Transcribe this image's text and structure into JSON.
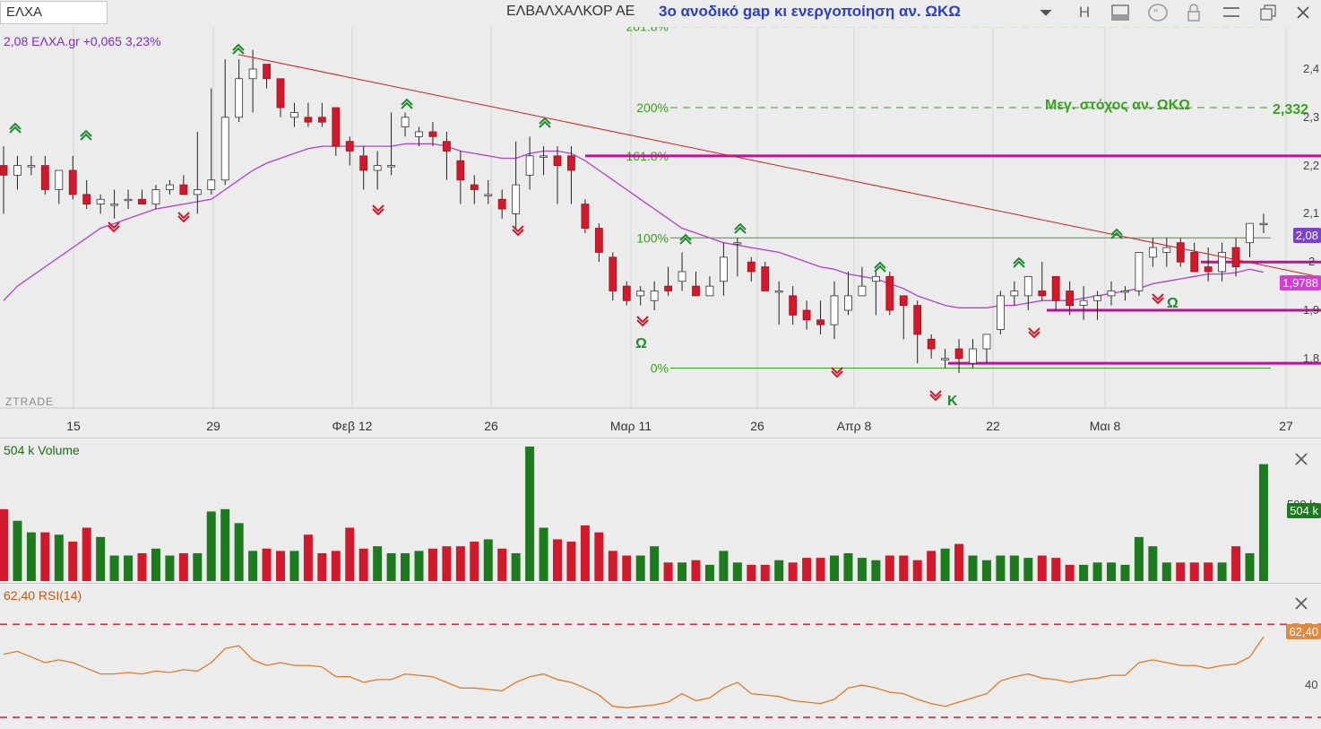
{
  "toolbar": {
    "symbol": "ΕΛΧΑ",
    "company": "ΕΛΒΑΛΧΑΛΚΟΡ ΑΕ",
    "annotation": "3ο ανοδικό gap κι ενεργοποίηση αν. ΩΚΩ",
    "h_label": "H",
    "icons": [
      "chevron-down-icon",
      "layout-icon",
      "quote-icon",
      "lock-icon",
      "menu-icon",
      "restore-icon",
      "close-icon"
    ]
  },
  "price_panel": {
    "header": "2,08 ΕΛΧΑ.gr +0,065 3,23%",
    "watermark": "ZTRADE",
    "y_ticks": [
      "2,4",
      "2,3",
      "2,2",
      "2,1",
      "2",
      "1,9",
      "1,8"
    ],
    "last_price": "2,08",
    "ma_value": "1,9788",
    "target_text": "Μεγ. στόχος αν.  ΩΚΩ",
    "target_value": "2,332",
    "fib_labels": [
      "261.8%",
      "200%",
      "161.8%",
      "100%",
      "0%"
    ],
    "pattern_labels": [
      "Ω",
      "Κ",
      "Ω"
    ]
  },
  "x_axis": {
    "labels": [
      "15",
      "29",
      "Φεβ 12",
      "26",
      "Μαρ 11",
      "26",
      "Απρ 8",
      "22",
      "Μαι 8",
      "27"
    ]
  },
  "volume_panel": {
    "header": "504 k Volume",
    "tick": "500 k",
    "last_label": "504 k"
  },
  "rsi_panel": {
    "header": "62,40 RSI(14)",
    "last_label": "62,40",
    "tick": "40"
  },
  "colors": {
    "up": "#1e7a1e",
    "down": "#d0192a",
    "ma": "#b040d0",
    "trend": "#d02020",
    "magenta": "#c0109a",
    "fib": "#3aa020",
    "rsi": "#e07a2a"
  },
  "chart_data": {
    "type": "candlestick",
    "x": [
      "Jan 9",
      "Jan 10",
      "Jan 11",
      "Jan 12",
      "Jan 15",
      "Jan 16",
      "Jan 17",
      "Jan 18",
      "Jan 19",
      "Jan 22",
      "Jan 23",
      "Jan 24",
      "Jan 25",
      "Jan 26",
      "Jan 29",
      "Jan 30",
      "Jan 31",
      "Feb 1",
      "Feb 2",
      "Feb 5",
      "Feb 6",
      "Feb 7",
      "Feb 8",
      "Feb 9",
      "Feb 12",
      "Feb 13",
      "Feb 14",
      "Feb 15",
      "Feb 16",
      "Feb 19",
      "Feb 20",
      "Feb 21",
      "Feb 22",
      "Feb 23",
      "Feb 26",
      "Feb 27",
      "Feb 28",
      "Feb 29",
      "Mar 1",
      "Mar 4",
      "Mar 5",
      "Mar 6",
      "Mar 7",
      "Mar 8",
      "Mar 11",
      "Mar 12",
      "Mar 13",
      "Mar 14",
      "Mar 15",
      "Mar 18",
      "Mar 19",
      "Mar 20",
      "Mar 21",
      "Mar 22",
      "Mar 26",
      "Mar 27",
      "Mar 28",
      "Mar 29",
      "Apr 1",
      "Apr 2",
      "Apr 3",
      "Apr 4",
      "Apr 5",
      "Apr 8",
      "Apr 9",
      "Apr 10",
      "Apr 11",
      "Apr 12",
      "Apr 15",
      "Apr 16",
      "Apr 17",
      "Apr 18",
      "Apr 19",
      "Apr 22",
      "Apr 23",
      "Apr 24",
      "Apr 25",
      "Apr 26",
      "Apr 29",
      "Apr 30",
      "May 2",
      "May 3",
      "May 6",
      "May 7",
      "May 8",
      "May 9",
      "May 10",
      "May 13",
      "May 14",
      "May 15",
      "May 16",
      "May 17"
    ],
    "open": [
      2.2,
      2.18,
      2.2,
      2.2,
      2.15,
      2.19,
      2.14,
      2.12,
      2.12,
      2.13,
      2.13,
      2.12,
      2.15,
      2.16,
      2.14,
      2.15,
      2.17,
      2.3,
      2.38,
      2.41,
      2.38,
      2.3,
      2.3,
      2.3,
      2.32,
      2.25,
      2.22,
      2.19,
      2.2,
      2.28,
      2.26,
      2.27,
      2.25,
      2.21,
      2.16,
      2.14,
      2.13,
      2.1,
      2.18,
      2.22,
      2.22,
      2.22,
      2.12,
      2.07,
      2.01,
      1.95,
      1.93,
      1.92,
      1.95,
      1.96,
      1.95,
      1.93,
      1.96,
      2.04,
      2.0,
      1.99,
      1.94,
      1.93,
      1.9,
      1.88,
      1.87,
      1.9,
      1.93,
      1.96,
      1.97,
      1.93,
      1.91,
      1.84,
      1.8,
      1.82,
      1.79,
      1.82,
      1.86,
      1.93,
      1.93,
      1.94,
      1.97,
      1.94,
      1.91,
      1.92,
      1.93,
      1.94,
      1.94,
      2.01,
      2.02,
      2.04,
      2.02,
      1.99,
      1.98,
      2.03,
      2.04,
      2.08
    ],
    "high": [
      2.24,
      2.22,
      2.22,
      2.22,
      2.18,
      2.22,
      2.17,
      2.14,
      2.15,
      2.15,
      2.15,
      2.16,
      2.17,
      2.18,
      2.27,
      2.36,
      2.42,
      2.42,
      2.44,
      2.41,
      2.38,
      2.33,
      2.33,
      2.33,
      2.32,
      2.26,
      2.24,
      2.23,
      2.31,
      2.31,
      2.28,
      2.29,
      2.27,
      2.23,
      2.18,
      2.17,
      2.15,
      2.25,
      2.26,
      2.24,
      2.24,
      2.24,
      2.13,
      2.08,
      2.02,
      1.96,
      1.95,
      1.96,
      1.99,
      2.02,
      1.98,
      1.97,
      2.04,
      2.05,
      2.01,
      2.0,
      1.96,
      1.95,
      1.92,
      1.92,
      1.96,
      1.98,
      1.99,
      1.98,
      1.98,
      1.93,
      1.92,
      1.85,
      1.82,
      1.84,
      1.84,
      1.83,
      1.94,
      1.96,
      1.97,
      2.0,
      1.97,
      1.96,
      1.95,
      1.94,
      1.96,
      1.95,
      2.02,
      2.05,
      2.05,
      2.05,
      2.04,
      2.03,
      2.04,
      2.05,
      2.07,
      2.1
    ],
    "low": [
      2.1,
      2.15,
      2.18,
      2.14,
      2.12,
      2.13,
      2.11,
      2.1,
      2.09,
      2.11,
      2.12,
      2.11,
      2.14,
      2.14,
      2.1,
      2.14,
      2.16,
      2.29,
      2.31,
      2.36,
      2.3,
      2.28,
      2.28,
      2.28,
      2.22,
      2.2,
      2.15,
      2.15,
      2.18,
      2.26,
      2.24,
      2.24,
      2.17,
      2.12,
      2.12,
      2.12,
      2.09,
      2.07,
      2.15,
      2.18,
      2.12,
      2.12,
      2.06,
      2.0,
      1.92,
      1.91,
      1.91,
      1.9,
      1.93,
      1.94,
      1.93,
      1.93,
      1.93,
      1.97,
      1.96,
      1.94,
      1.87,
      1.87,
      1.86,
      1.85,
      1.84,
      1.89,
      1.93,
      1.89,
      1.89,
      1.84,
      1.79,
      1.8,
      1.78,
      1.77,
      1.78,
      1.79,
      1.85,
      1.91,
      1.9,
      1.92,
      1.9,
      1.89,
      1.88,
      1.88,
      1.91,
      1.92,
      1.93,
      1.99,
      1.99,
      1.99,
      1.98,
      1.96,
      1.96,
      1.97,
      2.01,
      2.06
    ],
    "close": [
      2.18,
      2.2,
      2.2,
      2.15,
      2.19,
      2.14,
      2.12,
      2.13,
      2.12,
      2.13,
      2.12,
      2.15,
      2.16,
      2.14,
      2.15,
      2.17,
      2.3,
      2.38,
      2.4,
      2.38,
      2.32,
      2.31,
      2.29,
      2.29,
      2.24,
      2.23,
      2.19,
      2.2,
      2.2,
      2.3,
      2.27,
      2.26,
      2.23,
      2.17,
      2.15,
      2.14,
      2.11,
      2.16,
      2.22,
      2.22,
      2.2,
      2.19,
      2.07,
      2.02,
      1.94,
      1.92,
      1.94,
      1.94,
      1.94,
      1.98,
      1.93,
      1.95,
      2.01,
      2.04,
      1.98,
      1.94,
      1.94,
      1.89,
      1.88,
      1.87,
      1.93,
      1.93,
      1.95,
      1.97,
      1.9,
      1.91,
      1.85,
      1.82,
      1.8,
      1.8,
      1.82,
      1.85,
      1.93,
      1.94,
      1.97,
      1.93,
      1.92,
      1.91,
      1.92,
      1.93,
      1.94,
      1.94,
      2.02,
      2.03,
      2.03,
      2.0,
      1.98,
      1.98,
      2.02,
      1.99,
      2.08,
      2.08
    ],
    "ma20": [
      1.92,
      1.95,
      1.97,
      1.99,
      2.01,
      2.03,
      2.05,
      2.07,
      2.08,
      2.09,
      2.1,
      2.11,
      2.115,
      2.12,
      2.125,
      2.13,
      2.15,
      2.17,
      2.19,
      2.205,
      2.215,
      2.225,
      2.235,
      2.24,
      2.24,
      2.24,
      2.24,
      2.24,
      2.24,
      2.245,
      2.245,
      2.245,
      2.24,
      2.23,
      2.225,
      2.22,
      2.215,
      2.215,
      2.225,
      2.23,
      2.23,
      2.225,
      2.21,
      2.19,
      2.17,
      2.15,
      2.13,
      2.11,
      2.09,
      2.07,
      2.06,
      2.05,
      2.04,
      2.035,
      2.03,
      2.025,
      2.02,
      2.01,
      2.0,
      1.99,
      1.985,
      1.975,
      1.97,
      1.965,
      1.955,
      1.945,
      1.93,
      1.92,
      1.91,
      1.905,
      1.905,
      1.905,
      1.91,
      1.91,
      1.915,
      1.92,
      1.92,
      1.92,
      1.925,
      1.93,
      1.935,
      1.94,
      1.945,
      1.955,
      1.96,
      1.965,
      1.97,
      1.975,
      1.975,
      1.978,
      1.985,
      1.9788
    ],
    "volume": [
      310,
      260,
      210,
      210,
      200,
      170,
      230,
      190,
      110,
      110,
      120,
      140,
      110,
      120,
      120,
      300,
      310,
      250,
      130,
      140,
      130,
      130,
      200,
      120,
      130,
      230,
      140,
      150,
      120,
      120,
      130,
      140,
      150,
      150,
      170,
      180,
      140,
      120,
      580,
      230,
      180,
      170,
      240,
      210,
      130,
      110,
      110,
      150,
      80,
      80,
      90,
      70,
      130,
      80,
      70,
      70,
      90,
      80,
      100,
      100,
      110,
      120,
      100,
      90,
      110,
      110,
      90,
      130,
      140,
      160,
      110,
      90,
      110,
      110,
      100,
      110,
      100,
      70,
      70,
      80,
      80,
      70,
      190,
      150,
      80,
      80,
      80,
      80,
      80,
      150,
      120,
      504
    ],
    "rsi": [
      50,
      52,
      48,
      44,
      46,
      44,
      40,
      36,
      36,
      37,
      36,
      38,
      37,
      39,
      38,
      44,
      54,
      56,
      46,
      42,
      44,
      42,
      42,
      41,
      34,
      34,
      30,
      32,
      32,
      36,
      35,
      34,
      30,
      26,
      26,
      25,
      24,
      30,
      34,
      36,
      32,
      30,
      26,
      21,
      13,
      12,
      13,
      14,
      16,
      22,
      17,
      19,
      26,
      30,
      22,
      21,
      20,
      17,
      16,
      15,
      18,
      26,
      28,
      26,
      23,
      22,
      18,
      15,
      13,
      16,
      19,
      22,
      31,
      34,
      36,
      33,
      32,
      30,
      32,
      33,
      35,
      35,
      44,
      46,
      44,
      42,
      42,
      40,
      42,
      43,
      48,
      62.4
    ],
    "y_range": [
      1.74,
      2.44
    ],
    "rsi_levels": [
      70,
      30
    ],
    "fib_levels": {
      "0%": 1.78,
      "100%": 2.05,
      "161.8%": 2.22,
      "200%": 2.32,
      "261.8%": 2.488
    },
    "target": 2.332,
    "trendline": {
      "from": [
        "Jan 30",
        2.43
      ],
      "to": [
        "May 17",
        1.95
      ]
    },
    "support_lines": [
      2.22,
      2.0,
      1.9,
      1.79
    ]
  }
}
